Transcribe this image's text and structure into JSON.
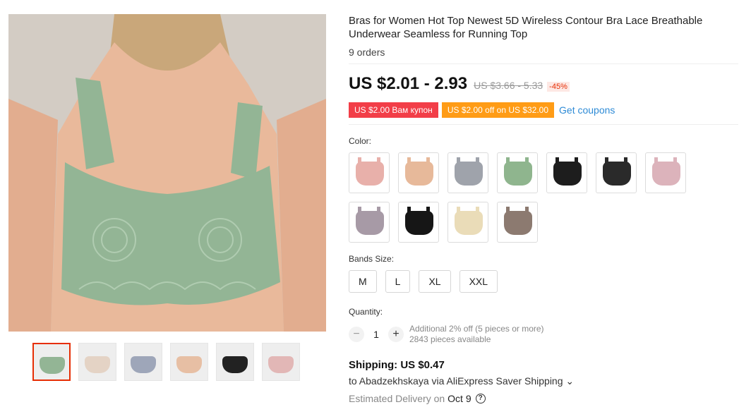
{
  "product": {
    "title": "Bras for Women Hot Top Newest 5D Wireless Contour Bra Lace Breathable Underwear Seamless for Running Top",
    "orders": "9 orders"
  },
  "price": {
    "current": "US $2.01 - 2.93",
    "original": "US $3.66 - 5.33",
    "discount": "-45%"
  },
  "coupons": {
    "coupon1": "US $2.00 Вам купон",
    "coupon2": "US $2.00 off on US $32.00",
    "get_coupons": "Get coupons"
  },
  "color": {
    "label": "Color:",
    "swatches": [
      {
        "name": "pink",
        "color": "#e8b0aa"
      },
      {
        "name": "beige",
        "color": "#e7b99a"
      },
      {
        "name": "gray",
        "color": "#9fa3ab"
      },
      {
        "name": "green",
        "color": "#8fb58e"
      },
      {
        "name": "black-lace",
        "color": "#1d1d1d"
      },
      {
        "name": "black",
        "color": "#2a2a2a"
      },
      {
        "name": "light-pink",
        "color": "#dcb3bb"
      },
      {
        "name": "purple-gray",
        "color": "#a79aa6"
      },
      {
        "name": "black-2",
        "color": "#161616"
      },
      {
        "name": "cream",
        "color": "#eadcb8"
      },
      {
        "name": "coffee",
        "color": "#8c7a70"
      }
    ]
  },
  "sizes": {
    "label": "Bands Size:",
    "options": [
      "M",
      "L",
      "XL",
      "XXL"
    ]
  },
  "quantity": {
    "label": "Quantity:",
    "minus": "−",
    "value": "1",
    "plus": "+",
    "additional": "Additional 2% off (5 pieces or more)",
    "available": "2843 pieces available"
  },
  "shipping": {
    "title": "Shipping: US $0.47",
    "to": "to Abadzekhskaya via AliExpress Saver Shipping ⌄",
    "delivery_label": "Estimated Delivery on",
    "delivery_date": "Oct 9",
    "help_icon": "?"
  },
  "gallery": {
    "main_color": "#93b595",
    "thumbs": [
      {
        "name": "green",
        "color": "#93b595"
      },
      {
        "name": "beige-white",
        "color": "#e4d3c5"
      },
      {
        "name": "gray",
        "color": "#9ea6b9"
      },
      {
        "name": "beige",
        "color": "#e7bfa4"
      },
      {
        "name": "black",
        "color": "#222222"
      },
      {
        "name": "pink",
        "color": "#e2b7b6"
      }
    ]
  }
}
